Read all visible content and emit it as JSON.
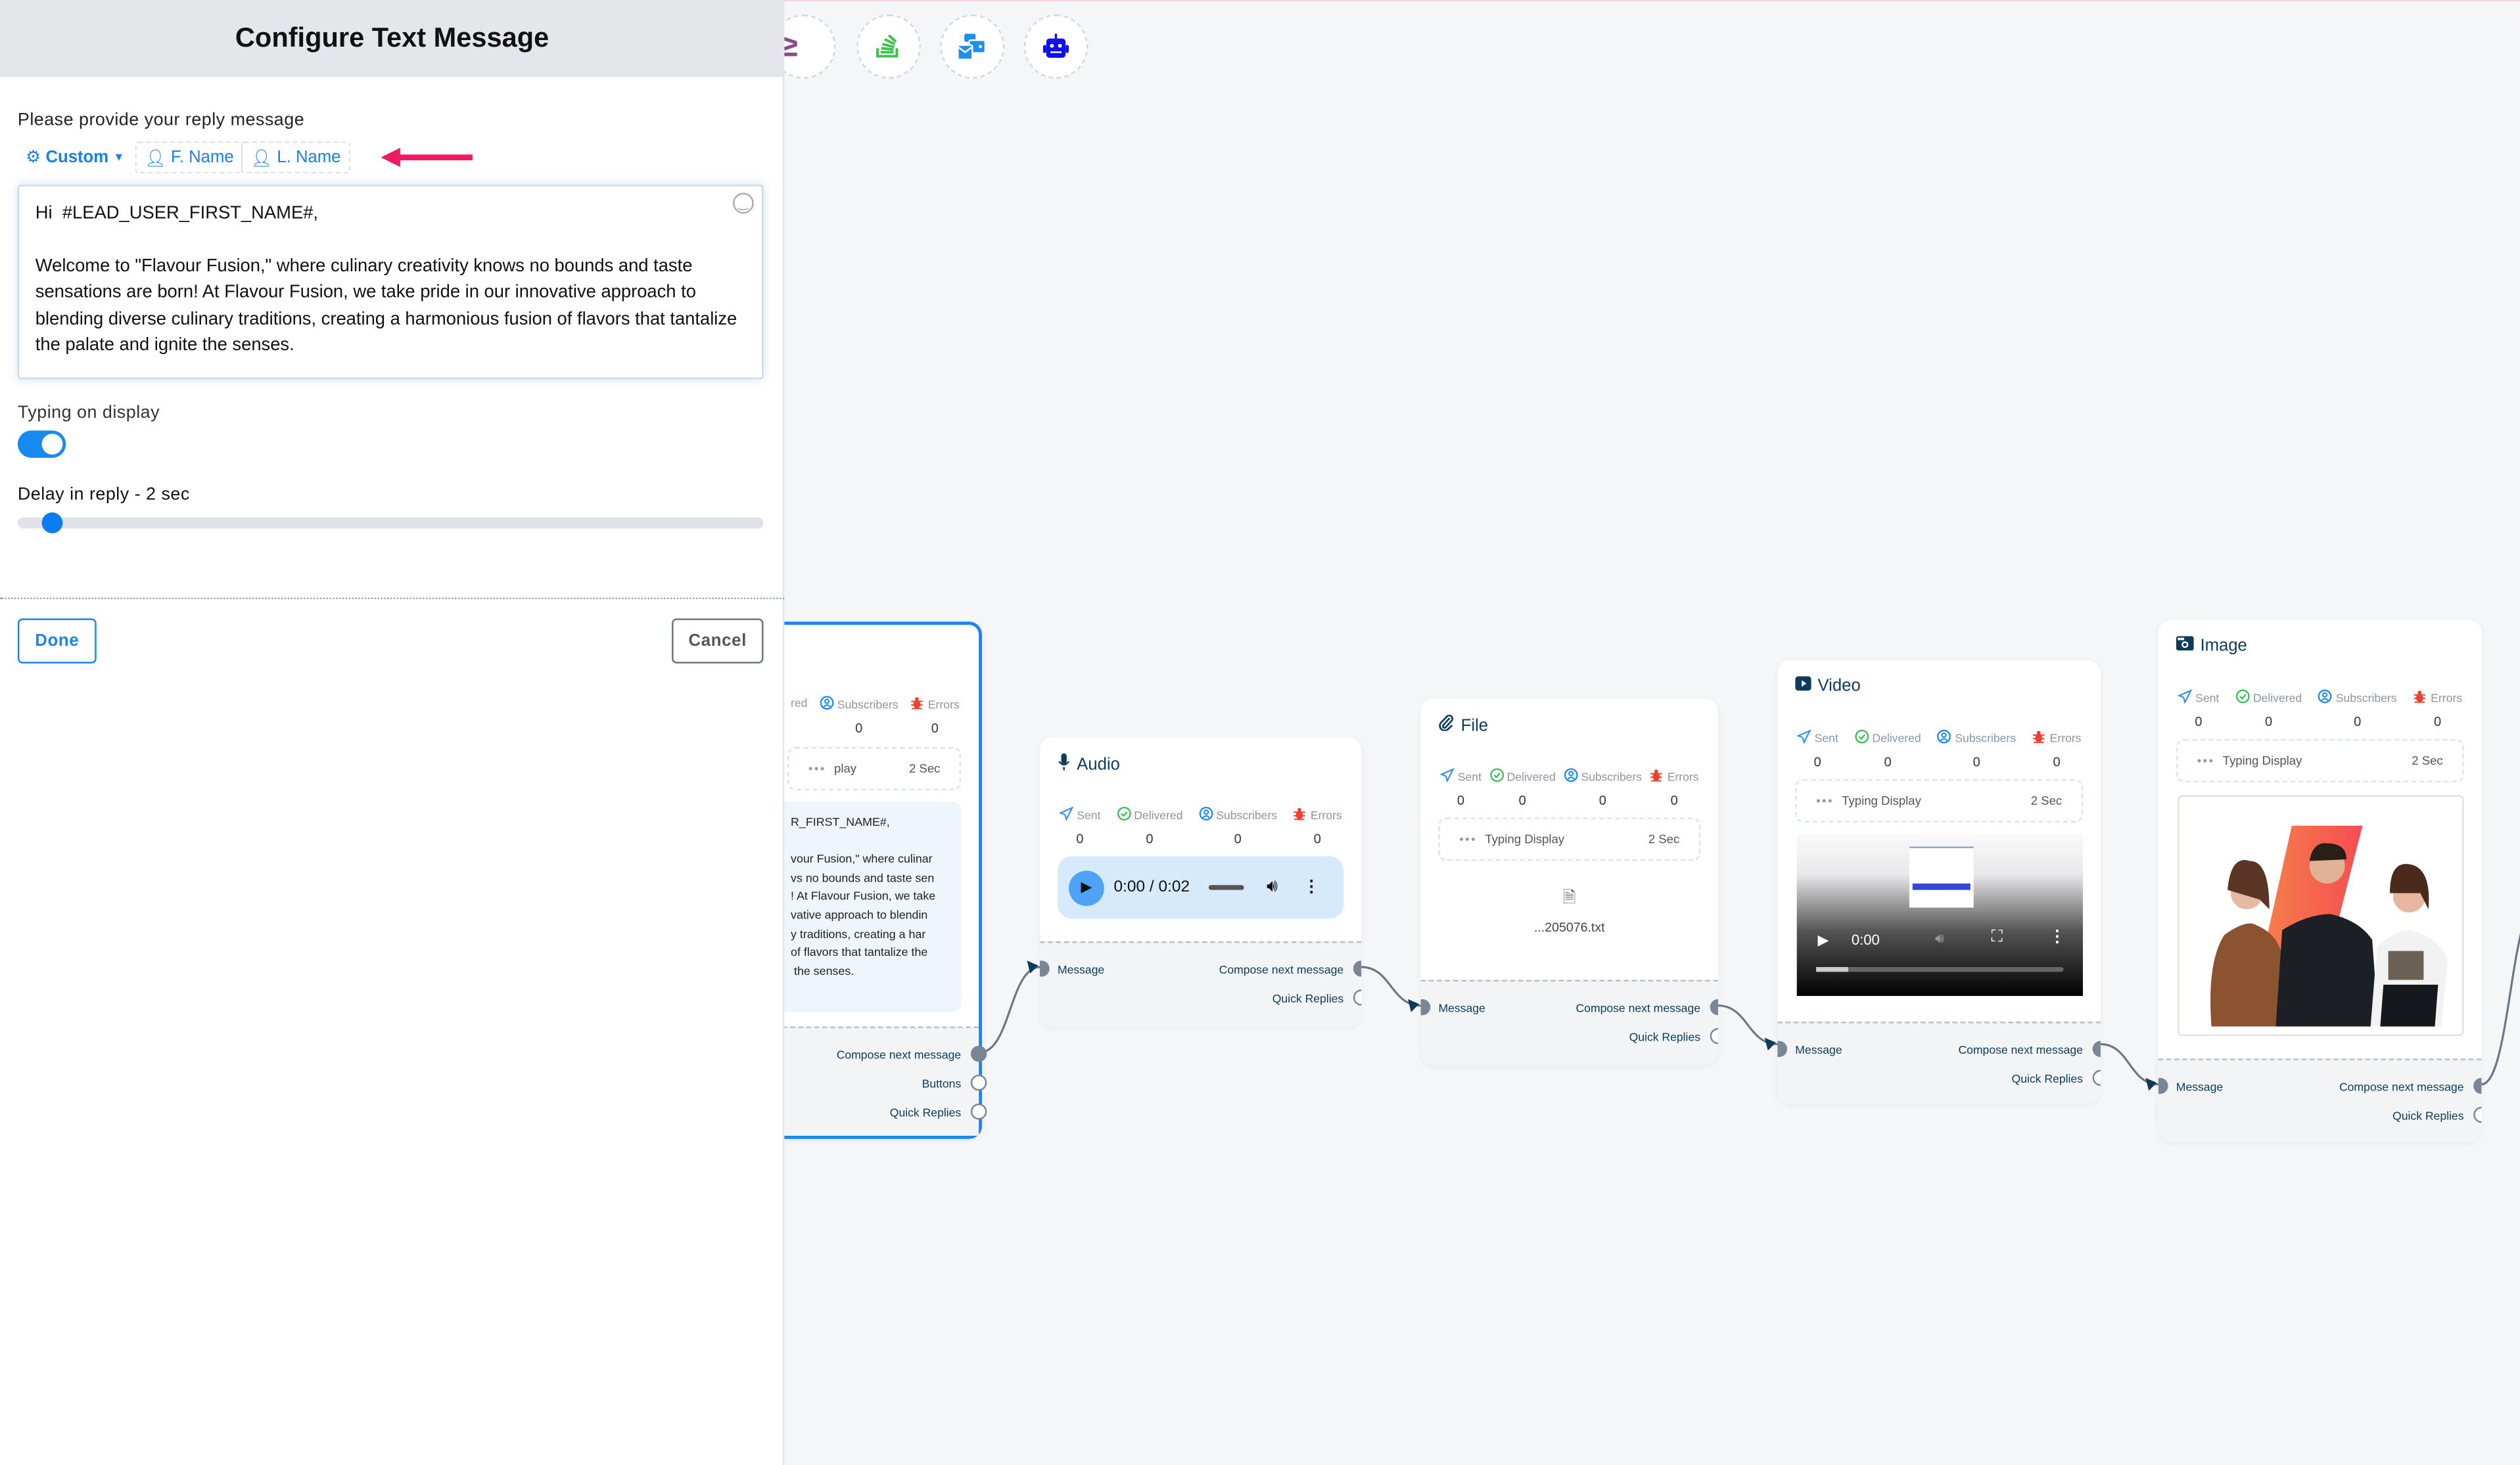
{
  "panel": {
    "title": "Configure Text Message",
    "prompt": "Please provide your reply message",
    "chips": {
      "custom": "Custom",
      "first_name": "F. Name",
      "last_name": "L. Name"
    },
    "message": "Hi  #LEAD_USER_FIRST_NAME#,\n\nWelcome to \"Flavour Fusion,\" where culinary creativity knows no bounds and taste sensations are born! At Flavour Fusion, we take pride in our innovative approach to blending diverse culinary traditions, creating a harmonious fusion of flavors that tantalize the palate and ignite the senses.",
    "typing_label": "Typing on display",
    "typing_on": true,
    "delay_label": "Delay in reply  -  2 sec",
    "delay_value_sec": 2,
    "done": "Done",
    "cancel": "Cancel"
  },
  "toolbar_icons": [
    "greater-equal-icon",
    "stack-overflow-icon",
    "messages-icon",
    "robot-icon"
  ],
  "colors": {
    "accent": "#1a84f2",
    "node_title": "#0d3b5a",
    "error": "#f0412f",
    "delivered": "#2fbf4a",
    "annotation_arrow": "#ee1c62"
  },
  "stat_labels": {
    "sent": "Sent",
    "delivered": "Delivered",
    "subscribers": "Subscribers",
    "errors": "Errors"
  },
  "nodes": [
    {
      "type": "text",
      "stats": {
        "delivered_label": "red",
        "subscribers": "0",
        "errors": "0"
      },
      "typing": {
        "label": "play",
        "value": "2 Sec"
      },
      "preview": "R_FIRST_NAME#,\n\nvour Fusion,\" where culinar\nvs no bounds and taste sen\n! At Flavour Fusion, we take\nvative approach to blendin\ny traditions, creating a har\nof flavors that tantalize the\n the senses.",
      "outputs": [
        "Compose next message",
        "Buttons",
        "Quick Replies"
      ]
    },
    {
      "type": "audio",
      "title": "Audio",
      "stats": {
        "sent": "0",
        "delivered": "0",
        "subscribers": "0",
        "errors": "0"
      },
      "player_time": "0:00 / 0:02",
      "input": "Message",
      "outputs": [
        "Compose next message",
        "Quick Replies"
      ]
    },
    {
      "type": "file",
      "title": "File",
      "stats": {
        "sent": "0",
        "delivered": "0",
        "subscribers": "0",
        "errors": "0"
      },
      "typing": {
        "label": "Typing Display",
        "value": "2 Sec"
      },
      "filename": "...205076.txt",
      "input": "Message",
      "outputs": [
        "Compose next message",
        "Quick Replies"
      ]
    },
    {
      "type": "video",
      "title": "Video",
      "stats": {
        "sent": "0",
        "delivered": "0",
        "subscribers": "0",
        "errors": "0"
      },
      "typing": {
        "label": "Typing Display",
        "value": "2 Sec"
      },
      "video_time": "0:00",
      "input": "Message",
      "outputs": [
        "Compose next message",
        "Quick Replies"
      ]
    },
    {
      "type": "image",
      "title": "Image",
      "stats": {
        "sent": "0",
        "delivered": "0",
        "subscribers": "0",
        "errors": "0"
      },
      "typing": {
        "label": "Typing Display",
        "value": "2 Sec"
      },
      "input": "Message",
      "outputs": [
        "Compose next message",
        "Quick Replies"
      ]
    }
  ]
}
